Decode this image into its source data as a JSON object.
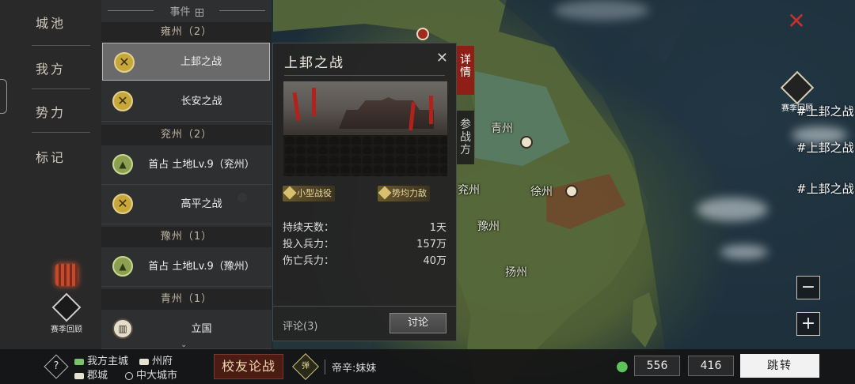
{
  "map": {
    "labels": [
      "青州",
      "兖州",
      "徐州",
      "豫州",
      "扬州"
    ],
    "news": [
      "#上邽之战",
      "#上邽之战",
      "#上邽之战"
    ],
    "review_badge": "赛季回顾",
    "zoom_out": "−",
    "zoom_in": "+",
    "close": "✕"
  },
  "nav": {
    "items": [
      "城池",
      "我方",
      "势力",
      "标记"
    ],
    "review_label": "赛季回顾"
  },
  "events": {
    "header": "事件",
    "groups": [
      {
        "region": "雍州（2）",
        "items": [
          {
            "name": "上邽之战",
            "icon": "crossed-swords-icon",
            "selected": true
          },
          {
            "name": "长安之战",
            "icon": "crossed-swords-icon"
          }
        ]
      },
      {
        "region": "兖州（2）",
        "items": [
          {
            "name": "首占 土地Lv.9（兖州）",
            "icon": "land-icon"
          },
          {
            "name": "高平之战",
            "icon": "crossed-swords-icon"
          }
        ]
      },
      {
        "region": "豫州（1）",
        "items": [
          {
            "name": "首占 土地Lv.9（豫州）",
            "icon": "land-icon"
          }
        ]
      },
      {
        "region": "青州（1）",
        "items": [
          {
            "name": "立国",
            "icon": "city-gate-icon"
          }
        ]
      }
    ]
  },
  "detail": {
    "title": "上邽之战",
    "tags": [
      "小型战役",
      "势均力敌"
    ],
    "stats": [
      {
        "label": "持续天数：",
        "value": "1天"
      },
      {
        "label": "投入兵力：",
        "value": "157万"
      },
      {
        "label": "伤亡兵力：",
        "value": "40万"
      }
    ],
    "comments": "评论(3)",
    "discuss_button": "讨论",
    "tab_details": "详情",
    "tab_participants": "参战方"
  },
  "bottom": {
    "help": "?",
    "legend": [
      "我方主城",
      "州府",
      "郡城",
      "中大城市"
    ],
    "brand": "校友论战",
    "emblem": "弹",
    "ruler": "帝辛:妹妹",
    "coord_x": "556",
    "coord_y": "416",
    "jump_button": "跳转"
  },
  "colors": {
    "accent_red": "#8e1f17",
    "legend_green": "#79c46a",
    "location_pin": "#5ec35a"
  }
}
